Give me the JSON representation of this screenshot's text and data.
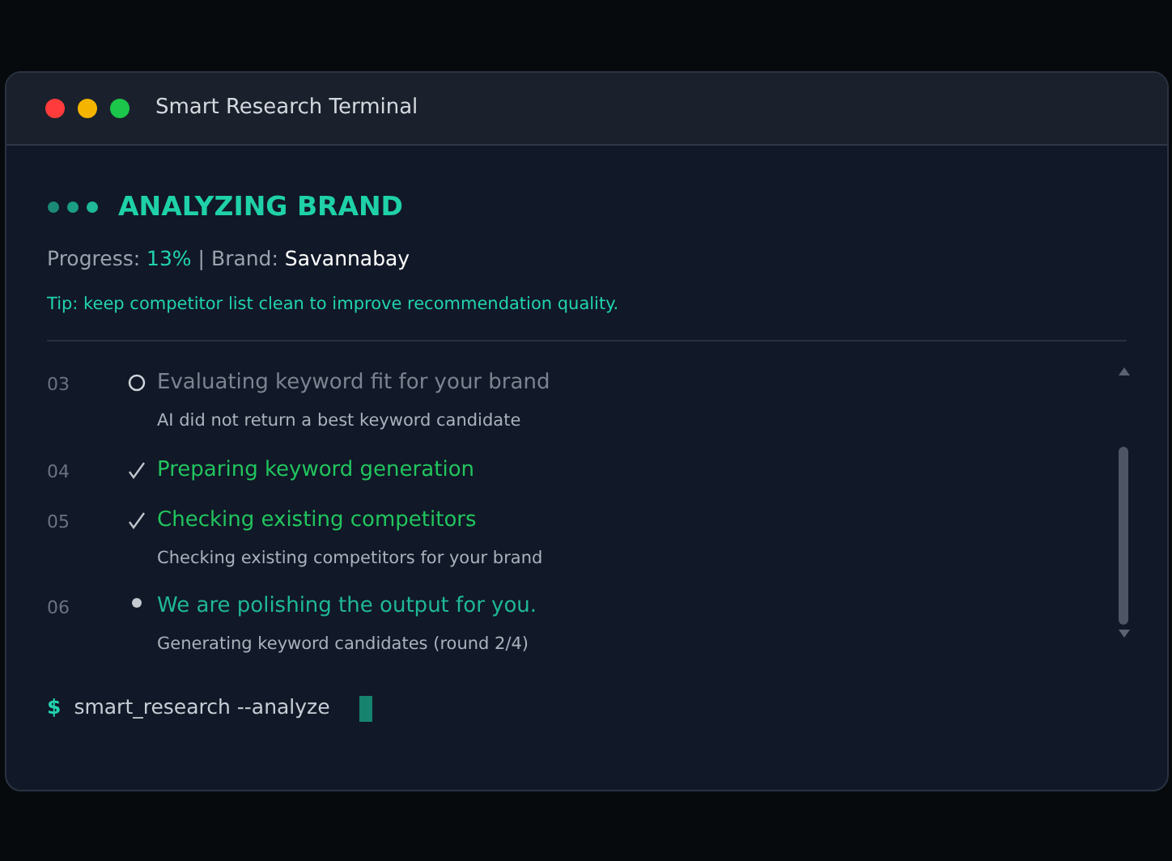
{
  "window": {
    "title": "Smart Research Terminal"
  },
  "status": {
    "heading": "ANALYZING BRAND",
    "progress_label": "Progress:",
    "progress_value": "13%",
    "separator": "|",
    "brand_label": "Brand:",
    "brand_value": "Savannabay",
    "tip": "Tip: keep competitor list clean to improve recommendation quality."
  },
  "steps": [
    {
      "number": "03",
      "kind": "failed",
      "title": "Evaluating keyword fit for your brand",
      "detail": "AI did not return a best keyword candidate"
    },
    {
      "number": "04",
      "kind": "done",
      "title": "Preparing keyword generation"
    },
    {
      "number": "05",
      "kind": "done",
      "title": "Checking existing competitors",
      "detail": "Checking existing competitors for your brand"
    },
    {
      "number": "06",
      "kind": "active",
      "title": "We are polishing the output for you.",
      "detail": "Generating keyword candidates (round 2/4)"
    }
  ],
  "prompt": {
    "symbol": "$",
    "command": "smart_research --analyze"
  }
}
